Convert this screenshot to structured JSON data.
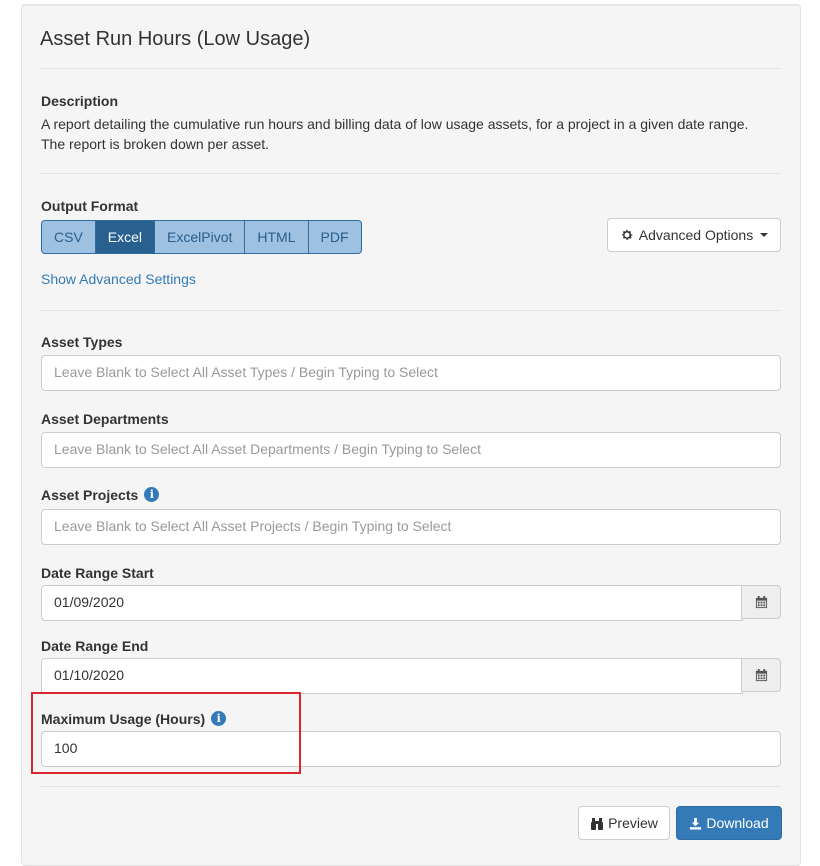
{
  "title": "Asset Run Hours (Low Usage)",
  "description": {
    "heading": "Description",
    "text_line1": "A report detailing the cumulative run hours and billing data of low usage assets, for a project in a given date range.",
    "text_line2": "The report is broken down per asset."
  },
  "output_format": {
    "heading": "Output Format",
    "options": [
      "CSV",
      "Excel",
      "ExcelPivot",
      "HTML",
      "PDF"
    ],
    "selected": "Excel"
  },
  "advanced_options_label": "Advanced Options",
  "show_advanced_settings": "Show Advanced Settings",
  "fields": {
    "asset_types": {
      "label": "Asset Types",
      "placeholder": "Leave Blank to Select All Asset Types / Begin Typing to Select"
    },
    "asset_departments": {
      "label": "Asset Departments",
      "placeholder": "Leave Blank to Select All Asset Departments / Begin Typing to Select"
    },
    "asset_projects": {
      "label": "Asset Projects",
      "placeholder": "Leave Blank to Select All Asset Projects / Begin Typing to Select"
    },
    "date_start": {
      "label": "Date Range Start",
      "value": "01/09/2020"
    },
    "date_end": {
      "label": "Date Range End",
      "value": "01/10/2020"
    },
    "max_usage": {
      "label": "Maximum Usage (Hours)",
      "value": "100"
    }
  },
  "buttons": {
    "preview": "Preview",
    "download": "Download"
  },
  "colors": {
    "primary": "#337ab7",
    "active_format": "#286090",
    "format_btn": "#9ec1e2",
    "highlight": "#d9272e"
  },
  "icons": [
    "gear-icon",
    "caret-down-icon",
    "info-icon",
    "calendar-icon",
    "binoculars-icon",
    "download-icon"
  ]
}
